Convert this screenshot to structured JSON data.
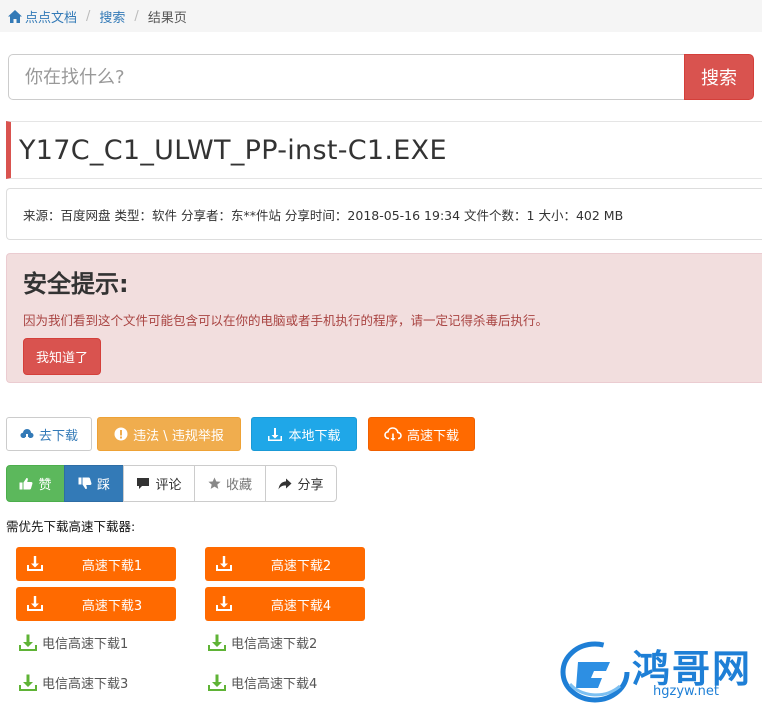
{
  "breadcrumb": {
    "home": "点点文档",
    "search": "搜索",
    "current": "结果页"
  },
  "search": {
    "placeholder": "你在找什么?",
    "button": "搜索"
  },
  "file": {
    "title": "Y17C_C1_ULWT_PP-inst-C1.EXE",
    "meta": "来源：百度网盘 类型：软件 分享者：东**件站 分享时间：2018-05-16 19:34 文件个数：1 大小：402 MB"
  },
  "alert": {
    "title": "安全提示:",
    "text": "因为我们看到这个文件可能包含可以在你的电脑或者手机执行的程序，请一定记得杀毒后执行。",
    "button": "我知道了"
  },
  "actions": {
    "go_download": "去下载",
    "report": "违法 \\ 违规举报",
    "local_download": "本地下载",
    "fast_download": "高速下载"
  },
  "vote": {
    "like": "赞",
    "dislike": "踩",
    "comment": "评论",
    "favorite": "收藏",
    "share": "分享"
  },
  "download_note": "需优先下载高速下载器:",
  "fast_buttons": [
    "高速下载1",
    "高速下载2",
    "高速下载3",
    "高速下载4"
  ],
  "telecom_links": [
    "电信高速下载1",
    "电信高速下载2",
    "电信高速下载3",
    "电信高速下载4"
  ],
  "watermark": {
    "name": "鸿哥网",
    "url": "hgzyw.net"
  },
  "colors": {
    "danger": "#d9534f",
    "link": "#337ab7",
    "orange": "#ff6a00",
    "info": "#1fa7e8",
    "warning": "#f0ad4e",
    "success": "#5cb85c",
    "green_icon": "#5fb336"
  }
}
